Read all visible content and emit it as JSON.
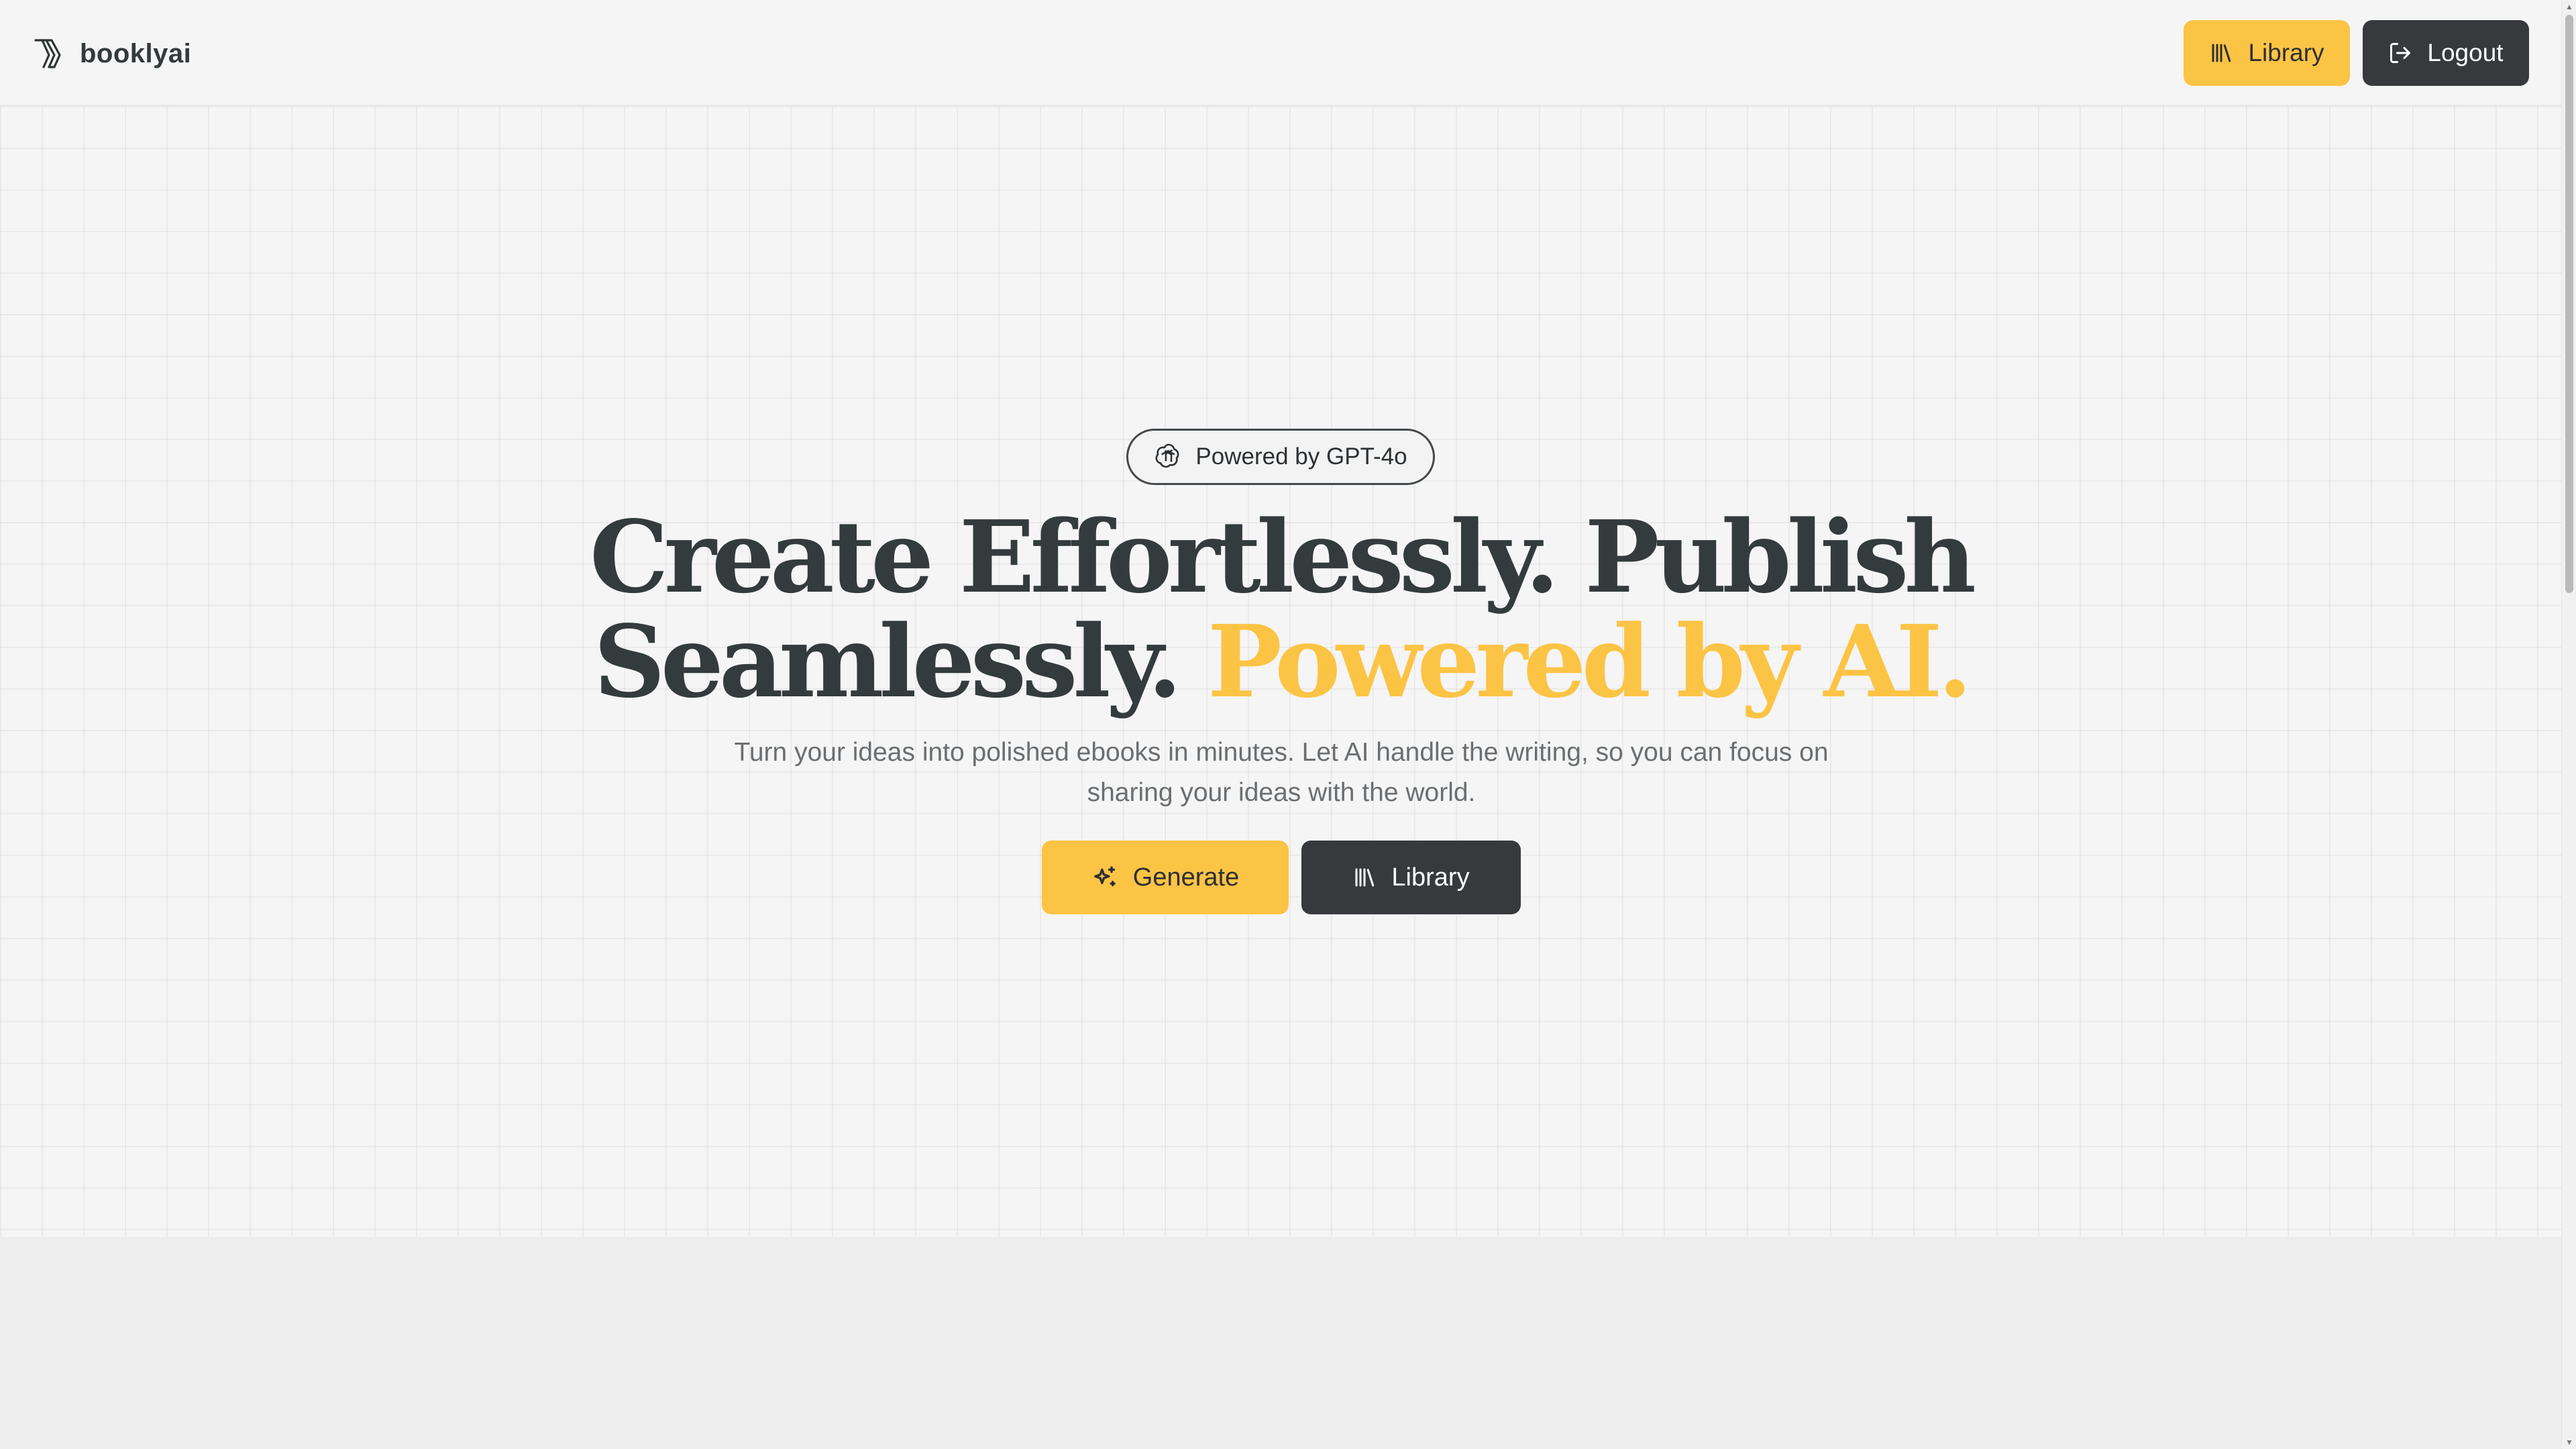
{
  "header": {
    "brand_name": "booklyai",
    "library_label": "Library",
    "logout_label": "Logout"
  },
  "hero": {
    "badge_label": "Powered by GPT-4o",
    "headline_line1": "Create Effortlessly. Publish",
    "headline_line2_dark": "Seamlessly.",
    "headline_line2_accent": "Powered by AI.",
    "subtitle_line1": "Turn your ideas into polished ebooks in minutes. Let AI handle the writing, so you can focus on",
    "subtitle_line2": "sharing your ideas with the world.",
    "generate_label": "Generate",
    "library_label": "Library"
  },
  "icons": {
    "brand": "booklyai-logo-icon",
    "library": "library-books-icon",
    "logout": "logout-icon",
    "openai": "openai-icon",
    "sparkles": "sparkles-icon"
  },
  "colors": {
    "accent": "#fcc445",
    "dark_button": "#37393d",
    "headline": "#343b3c",
    "background": "#f5f5f5"
  }
}
